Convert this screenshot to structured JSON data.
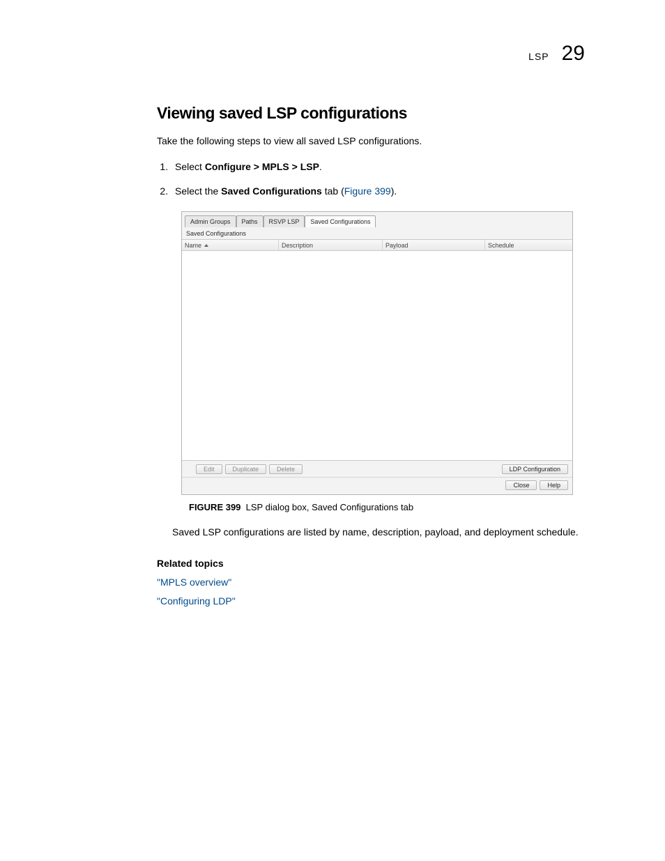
{
  "header": {
    "section_label": "LSP",
    "page_number": "29"
  },
  "title": "Viewing saved LSP configurations",
  "intro": "Take the following steps to view all saved LSP configurations.",
  "steps": [
    {
      "prefix": "Select ",
      "bold1": "Configure > MPLS > LSP",
      "suffix": "."
    },
    {
      "prefix": "Select the ",
      "bold1": "Saved Configurations",
      "mid": " tab (",
      "linkText": "Figure 399",
      "suffix": ")."
    }
  ],
  "dialog": {
    "tabs": [
      "Admin Groups",
      "Paths",
      "RSVP LSP",
      "Saved Configurations"
    ],
    "active_tab_index": 3,
    "panel_label": "Saved Configurations",
    "columns": {
      "name": "Name",
      "description": "Description",
      "payload": "Payload",
      "schedule": "Schedule"
    },
    "buttons": {
      "edit": "Edit",
      "duplicate": "Duplicate",
      "delete": "Delete",
      "ldp": "LDP Configuration",
      "close": "Close",
      "help": "Help"
    }
  },
  "figure": {
    "label": "FIGURE 399",
    "caption": "LSP dialog box, Saved Configurations tab"
  },
  "below_figure": "Saved LSP configurations are listed by name, description, payload, and deployment schedule.",
  "related": {
    "heading": "Related topics",
    "links": [
      "\"MPLS overview\"",
      "\"Configuring LDP\""
    ]
  }
}
